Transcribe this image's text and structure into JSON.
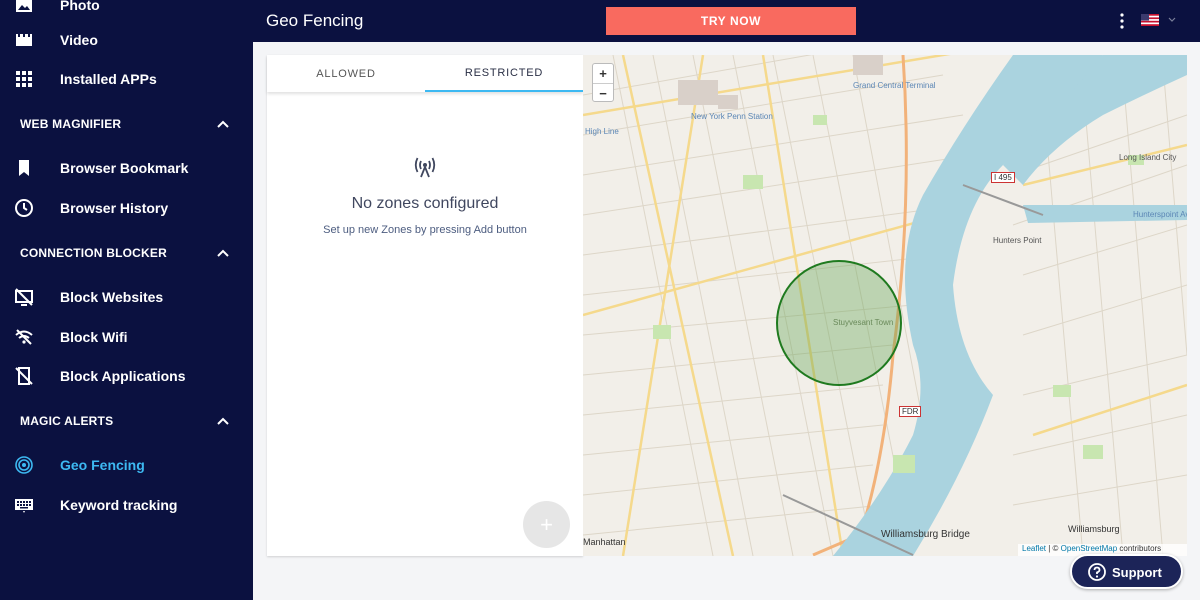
{
  "sidebar": {
    "items_top": [
      {
        "label": "Photo",
        "icon": "image-icon"
      },
      {
        "label": "Video",
        "icon": "video-icon"
      },
      {
        "label": "Installed APPs",
        "icon": "apps-grid-icon"
      }
    ],
    "sections": [
      {
        "title": "WEB MAGNIFIER",
        "items": [
          {
            "label": "Browser Bookmark",
            "icon": "bookmark-icon"
          },
          {
            "label": "Browser History",
            "icon": "clock-icon"
          }
        ]
      },
      {
        "title": "CONNECTION BLOCKER",
        "items": [
          {
            "label": "Block Websites",
            "icon": "monitor-off-icon"
          },
          {
            "label": "Block Wifi",
            "icon": "wifi-off-icon"
          },
          {
            "label": "Block Applications",
            "icon": "mobile-off-icon"
          }
        ]
      },
      {
        "title": "MAGIC ALERTS",
        "items": [
          {
            "label": "Geo Fencing",
            "icon": "target-icon",
            "active": true
          },
          {
            "label": "Keyword tracking",
            "icon": "keyboard-icon"
          }
        ]
      }
    ]
  },
  "header": {
    "title": "Geo Fencing",
    "cta_label": "TRY NOW"
  },
  "panel": {
    "tabs": [
      {
        "label": "ALLOWED",
        "active": false
      },
      {
        "label": "RESTRICTED",
        "active": true
      }
    ],
    "empty_title": "No zones configured",
    "empty_subtitle": "Set up new Zones by pressing Add button",
    "fab_label": "+"
  },
  "map": {
    "zoom_in": "+",
    "zoom_out": "−",
    "attribution_leaflet": "Leaflet",
    "attribution_sep": " | © ",
    "attribution_osm": "OpenStreetMap",
    "attribution_tail": " contributors",
    "labels": {
      "grand_central": "Grand Central Terminal",
      "penn_station": "New York Penn Station",
      "high_line": "High Line",
      "long_island_city": "Long Island City",
      "hunters_point": "Hunters Point",
      "hunterspoint_ave": "Hunterspoint Avenue",
      "stuyvesant_town": "Stuyvesant Town",
      "williamsburg_bridge": "Williamsburg Bridge",
      "williamsburg": "Williamsburg",
      "manhattan": "Manhattan",
      "fdr": "FDR",
      "i495": "I 495"
    },
    "colors": {
      "water": "#aad3df",
      "land": "#f2efe9",
      "fence_stroke": "#1f7a1f",
      "fence_fill": "#5aa04a"
    }
  },
  "support": {
    "label": "Support"
  },
  "colors": {
    "sidebar_bg": "#0b1140",
    "accent": "#3db9f2",
    "cta": "#f96a5f"
  }
}
